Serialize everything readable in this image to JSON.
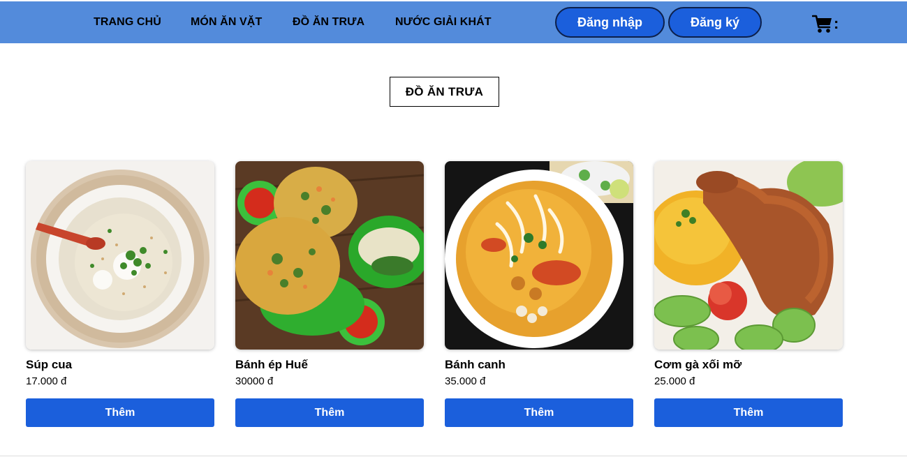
{
  "nav": {
    "links": [
      "TRANG CHỦ",
      "MÓN ĂN VẶT",
      "ĐỒ ĂN TRƯA",
      "NƯỚC GIẢI KHÁT"
    ],
    "login_label": "Đăng nhập",
    "register_label": "Đăng ký",
    "cart_icon": "shopping-cart-icon",
    "cart_suffix": ":"
  },
  "section": {
    "title": "ĐỒ ĂN TRƯA"
  },
  "products": [
    {
      "name": "Súp cua",
      "price": "17.000 đ",
      "button": "Thêm",
      "image": "crab-soup-photo"
    },
    {
      "name": "Bánh ép Huế",
      "price": "30000 đ",
      "button": "Thêm",
      "image": "banh-ep-hue-photo"
    },
    {
      "name": "Bánh canh",
      "price": "35.000 đ",
      "button": "Thêm",
      "image": "banh-canh-photo"
    },
    {
      "name": "Cơm gà xối mỡ",
      "price": "25.000 đ",
      "button": "Thêm",
      "image": "fried-chicken-rice-photo"
    }
  ],
  "colors": {
    "header_bg": "#538bdb",
    "button_bg": "#1b5fdc",
    "button_text": "#ffffff"
  }
}
